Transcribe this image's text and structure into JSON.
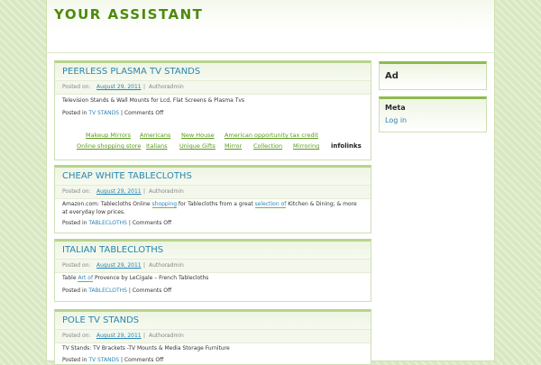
{
  "site": {
    "title": "YOUR ASSISTANT"
  },
  "meta_labels": {
    "posted_on": "Posted on:",
    "author_prefix": "Author:",
    "posted_in": "Posted in"
  },
  "posts": [
    {
      "title": "PEERLESS PLASMA TV STANDS",
      "date": "August 29, 2011",
      "author": "admin",
      "body": "Television Stands & Wall Mounts for Lcd, Flat Screens & Plasma Tvs",
      "category": "TV STANDS",
      "comments": "Comments Off"
    },
    {
      "title": "CHEAP WHITE TABLECLOTHS",
      "date": "August 29, 2011",
      "author": "admin",
      "body_1": "Amazon.com: Tablecloths Online ",
      "body_link_1": "shopping",
      "body_2": " for Tablecloths from a great ",
      "body_link_2": "selection of",
      "body_3": " Kitchen & Dining; & more at everyday low prices.",
      "category": "TABLECLOTHS",
      "comments": "Comments Off"
    },
    {
      "title": "ITALIAN TABLECLOTHS",
      "date": "August 29, 2011",
      "author": "admin",
      "body_1": "Table ",
      "body_link_1": "Art of",
      "body_2": " Provence by LeCigale – French Tablecloths",
      "category": "TABLECLOTHS",
      "comments": "Comments Off"
    },
    {
      "title": "POLE TV STANDS",
      "date": "August 29, 2011",
      "author": "admin",
      "body": "TV Stands: TV Brackets -TV Mounts & Media Storage Furniture",
      "category": "TV STANDS",
      "comments": "Comments Off"
    }
  ],
  "tags_row1": [
    "Makeup Mirrors",
    "Americans",
    "New House",
    "American opportunity tax credit"
  ],
  "tags_row2": [
    "Online shopping store",
    "Italians",
    "Unique Gifts",
    "Mirror",
    "Collection",
    "Mirroring"
  ],
  "infolinks": "infolinks",
  "sidebar": {
    "ad_title": "Ad",
    "meta_title": "Meta",
    "login": "Log in"
  }
}
